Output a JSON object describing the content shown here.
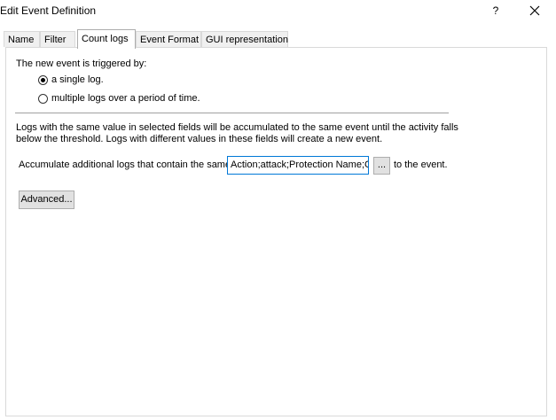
{
  "window": {
    "title": "Edit Event Definition",
    "help_label": "?"
  },
  "tabs": [
    {
      "label": "Name",
      "active": false
    },
    {
      "label": "Filter",
      "active": false
    },
    {
      "label": "Count logs",
      "active": true
    },
    {
      "label": "Event Format",
      "active": false
    },
    {
      "label": "GUI representation",
      "active": false
    }
  ],
  "trigger": {
    "heading": "The new event is triggered by:",
    "options": [
      {
        "label": "a single log.",
        "selected": true
      },
      {
        "label": "multiple logs over a period of time.",
        "selected": false
      }
    ]
  },
  "accumulate": {
    "description_line1": "Logs with the same value in selected fields will be accumulated to the same event until the activity falls",
    "description_line2": "below the threshold. Logs with different values in these fields will create a new event.",
    "prefix_label": "Accumulate additional logs that contain the same",
    "fields_value": "Action;attack;Protection Name;C",
    "browse_label": "...",
    "suffix_label": "to the event."
  },
  "buttons": {
    "advanced_label": "Advanced..."
  },
  "colors": {
    "focus_border": "#0078d7",
    "button_face": "#e1e1e1"
  }
}
